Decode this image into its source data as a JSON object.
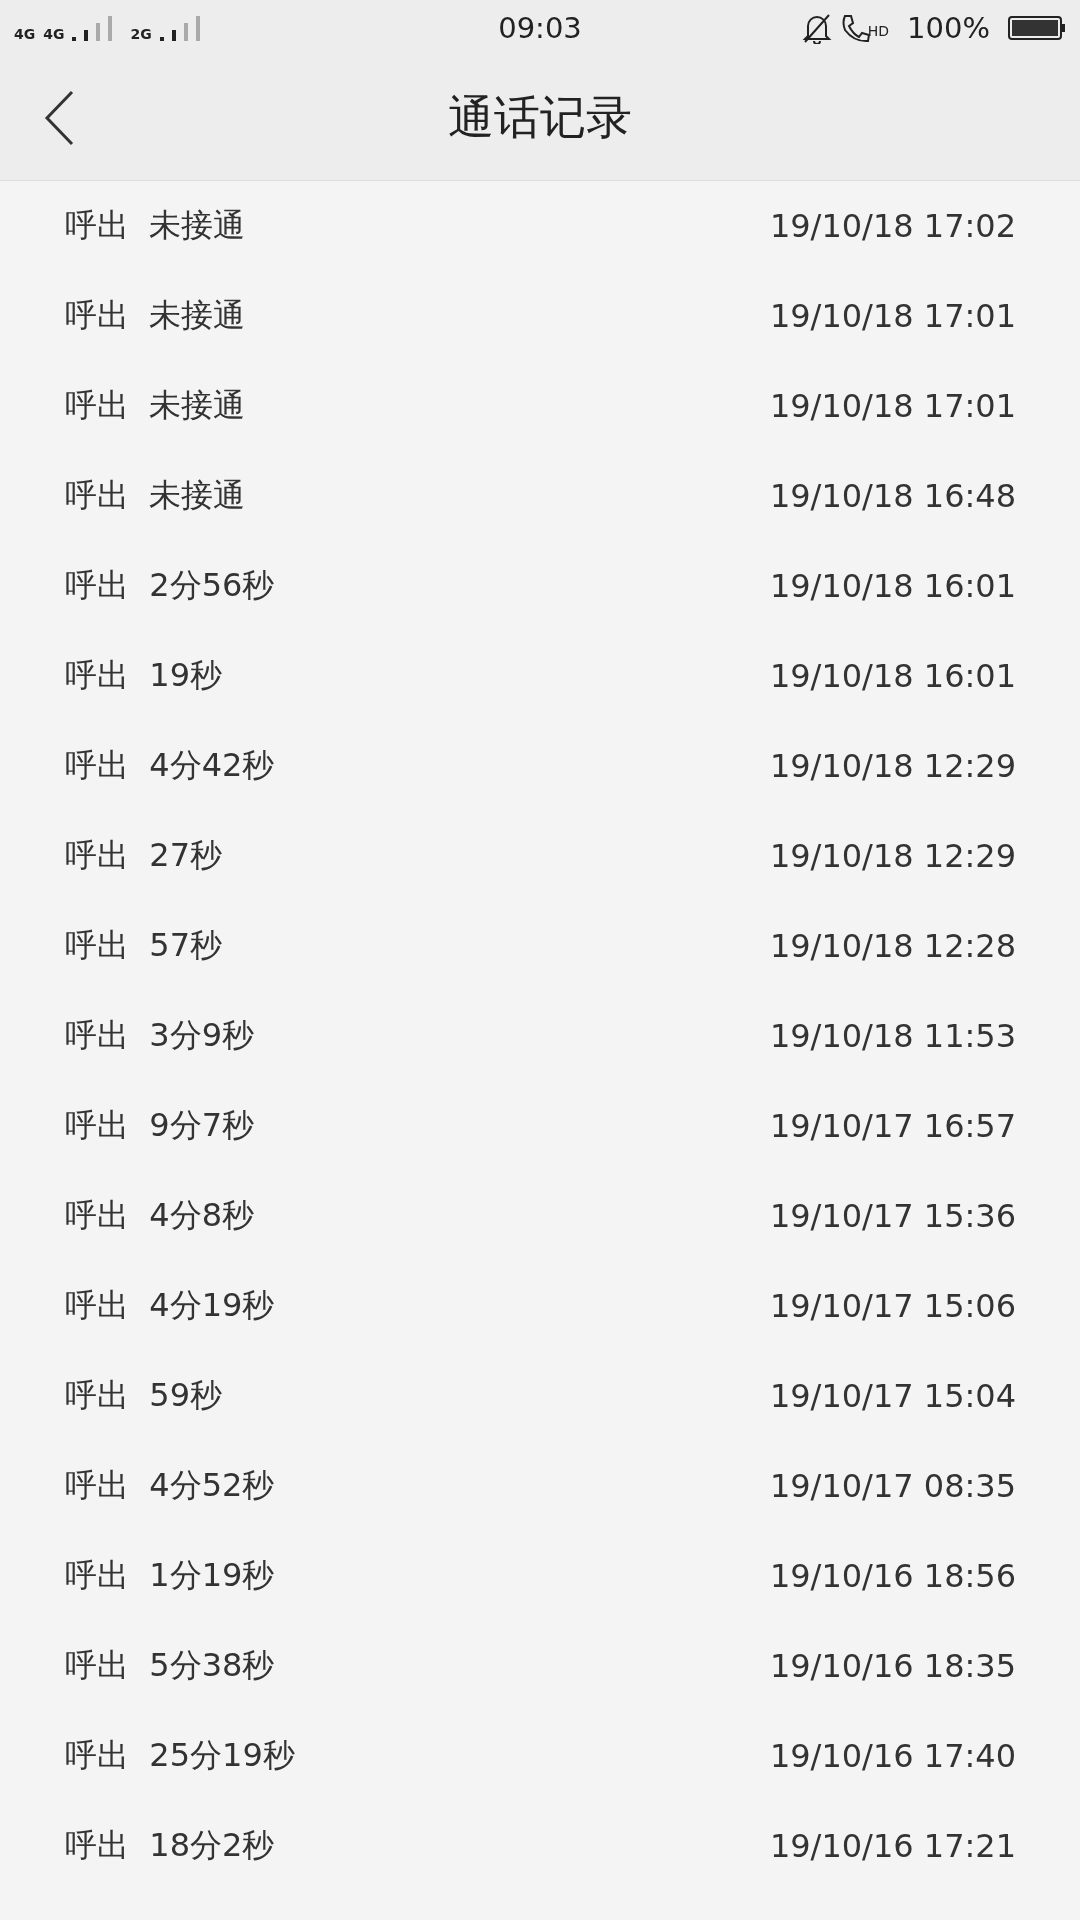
{
  "status_bar": {
    "networks": [
      "4G",
      "4G",
      "2G"
    ],
    "time": "09:03",
    "call_badge": "HD",
    "battery": "100%"
  },
  "header": {
    "title": "通话记录"
  },
  "calls": [
    {
      "direction": "呼出",
      "duration": "未接通",
      "time": "19/10/18 17:02"
    },
    {
      "direction": "呼出",
      "duration": "未接通",
      "time": "19/10/18 17:01"
    },
    {
      "direction": "呼出",
      "duration": "未接通",
      "time": "19/10/18 17:01"
    },
    {
      "direction": "呼出",
      "duration": "未接通",
      "time": "19/10/18 16:48"
    },
    {
      "direction": "呼出",
      "duration": "2分56秒",
      "time": "19/10/18 16:01"
    },
    {
      "direction": "呼出",
      "duration": "19秒",
      "time": "19/10/18 16:01"
    },
    {
      "direction": "呼出",
      "duration": "4分42秒",
      "time": "19/10/18 12:29"
    },
    {
      "direction": "呼出",
      "duration": "27秒",
      "time": "19/10/18 12:29"
    },
    {
      "direction": "呼出",
      "duration": "57秒",
      "time": "19/10/18 12:28"
    },
    {
      "direction": "呼出",
      "duration": "3分9秒",
      "time": "19/10/18 11:53"
    },
    {
      "direction": "呼出",
      "duration": "9分7秒",
      "time": "19/10/17 16:57"
    },
    {
      "direction": "呼出",
      "duration": "4分8秒",
      "time": "19/10/17 15:36"
    },
    {
      "direction": "呼出",
      "duration": "4分19秒",
      "time": "19/10/17 15:06"
    },
    {
      "direction": "呼出",
      "duration": "59秒",
      "time": "19/10/17 15:04"
    },
    {
      "direction": "呼出",
      "duration": "4分52秒",
      "time": "19/10/17 08:35"
    },
    {
      "direction": "呼出",
      "duration": "1分19秒",
      "time": "19/10/16 18:56"
    },
    {
      "direction": "呼出",
      "duration": "5分38秒",
      "time": "19/10/16 18:35"
    },
    {
      "direction": "呼出",
      "duration": "25分19秒",
      "time": "19/10/16 17:40"
    },
    {
      "direction": "呼出",
      "duration": "18分2秒",
      "time": "19/10/16 17:21"
    }
  ]
}
